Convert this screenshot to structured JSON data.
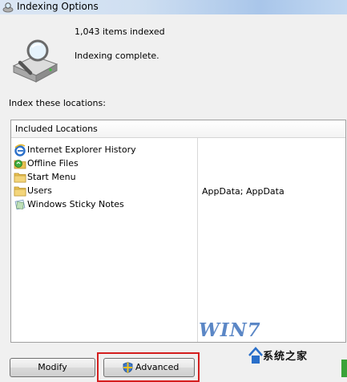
{
  "window": {
    "title": "Indexing Options"
  },
  "summary": {
    "items_indexed": "1,043 items indexed",
    "status": "Indexing complete."
  },
  "locations": {
    "section_label": "Index these locations:",
    "header": "Included Locations",
    "items": [
      {
        "label": "Internet Explorer History",
        "icon": "internet-explorer-icon"
      },
      {
        "label": "Offline Files",
        "icon": "offline-files-icon"
      },
      {
        "label": "Start Menu",
        "icon": "folder-icon"
      },
      {
        "label": "Users",
        "icon": "folder-icon"
      },
      {
        "label": "Windows Sticky Notes",
        "icon": "sticky-notes-icon"
      }
    ],
    "exclusions": "AppData; AppData"
  },
  "buttons": {
    "modify": "Modify",
    "advanced": "Advanced"
  },
  "watermark": {
    "brand": "WIN7",
    "site": "系统之家"
  },
  "colors": {
    "highlight": "#d41e1e",
    "folder": "#e8c052",
    "ie_blue": "#2a6fc9"
  }
}
